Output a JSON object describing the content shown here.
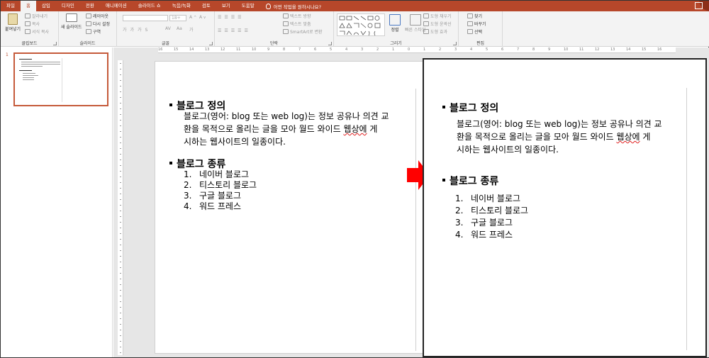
{
  "tabs": [
    "파일",
    "홈",
    "삽입",
    "디자인",
    "전환",
    "애니메이션",
    "슬라이드 쇼",
    "녹음/녹화",
    "검토",
    "보기",
    "도움말"
  ],
  "active_tab": "홈",
  "tell_me": "어떤 작업을 원하시나요?",
  "ribbon": {
    "clipboard": {
      "paste": "붙여넣기",
      "cut": "잘라내기",
      "copy": "복사",
      "format_painter": "서식 복사",
      "label": "클립보드"
    },
    "slides": {
      "new_slide": "새 슬라이드",
      "layout": "레이아웃",
      "reset": "다시 설정",
      "section": "구역",
      "label": "슬라이드"
    },
    "font": {
      "size": "18+",
      "label": "글꼴"
    },
    "paragraph": {
      "text_direction": "텍스트 방향",
      "align_text": "텍스트 맞춤",
      "smartart": "SmartArt로 변환",
      "label": "단락"
    },
    "drawing": {
      "arrange": "정렬",
      "quick_styles": "빠른 스타일",
      "shape_fill": "도형 채우기",
      "shape_outline": "도형 윤곽선",
      "shape_effects": "도형 효과",
      "label": "그리기"
    },
    "editing": {
      "find": "찾기",
      "replace": "바꾸기",
      "select": "선택",
      "label": "편집"
    }
  },
  "ruler_labels": [
    "16",
    "15",
    "14",
    "13",
    "12",
    "11",
    "10",
    "9",
    "8",
    "7",
    "6",
    "5",
    "4",
    "3",
    "2",
    "1",
    "0",
    "1",
    "2",
    "3",
    "4",
    "5",
    "6",
    "7",
    "8",
    "9",
    "10",
    "11",
    "12",
    "13",
    "14",
    "15",
    "16"
  ],
  "thumbnail": {
    "number": "1"
  },
  "slide": {
    "heading1": "블로그 정의",
    "body_lines": [
      "블로그(영어: blog 또는 web log)는 정보 공유나 의견 교",
      "환을 목적으로 올리는 글을 모아 월드 와이드 ",
      "시하는 웹사이트의 일종이다."
    ],
    "body_squiggle_word": "웹상에",
    "body_line2_tail": " 게",
    "heading2": "블로그 종류",
    "list": [
      {
        "num": "1.",
        "text": "네이버 블로그"
      },
      {
        "num": "2.",
        "text": "티스토리 블로그"
      },
      {
        "num": "3.",
        "text": "구글 블로그"
      },
      {
        "num": "4.",
        "text": "워드 프레스"
      }
    ]
  },
  "colors": {
    "accent": "#b7472a",
    "arrow": "#ff0000"
  }
}
